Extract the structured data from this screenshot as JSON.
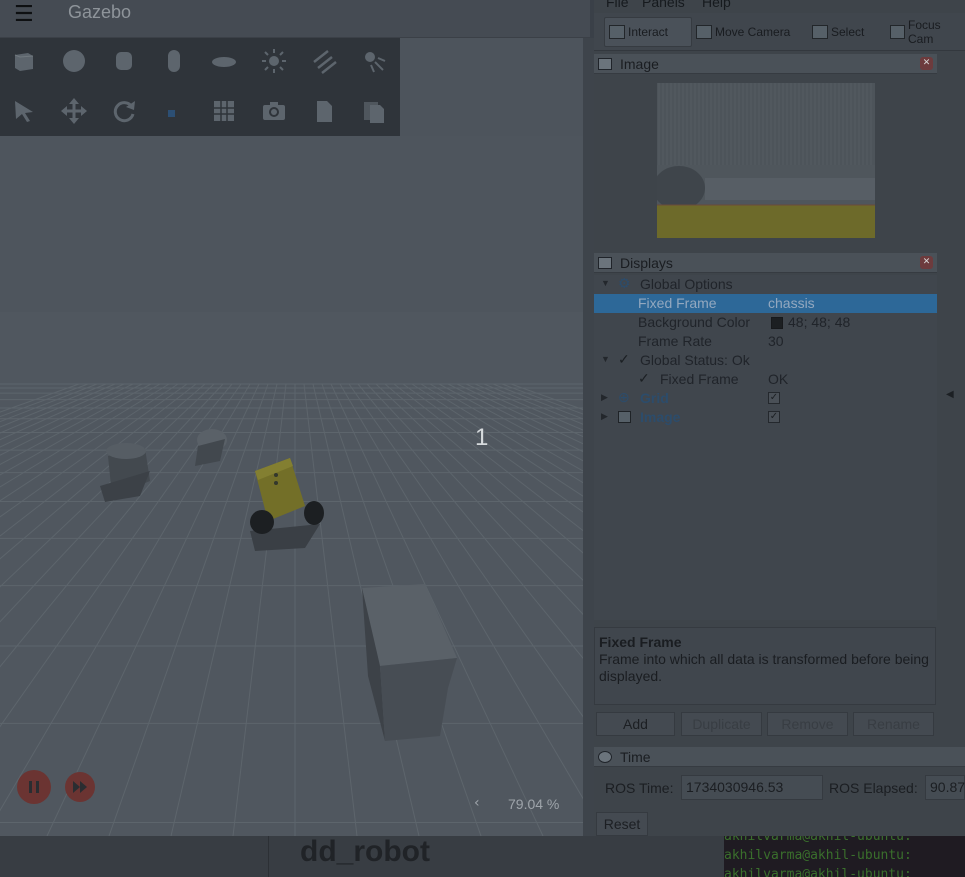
{
  "gazebo": {
    "title": "Gazebo",
    "menu_icon": "hamburger-icon",
    "toolbar_row1": [
      "box-icon",
      "sphere-icon",
      "cylinder-icon",
      "capsule-icon",
      "ellipsoid-icon",
      "point-light-icon",
      "directional-light-icon",
      "spot-light-icon"
    ],
    "toolbar_row2": [
      "select-arrow-icon",
      "translate-icon",
      "rotate-icon",
      "scale-icon",
      "align-grid-icon",
      "screenshot-icon",
      "copy-icon",
      "paste-icon"
    ],
    "scene_label": "1",
    "zoom_level": "79.04 %",
    "zoom_arrow": "‹",
    "accent_color": "#d1462f"
  },
  "rviz": {
    "menu": [
      "File",
      "Panels",
      "Help"
    ],
    "toolbar": {
      "interact": "Interact",
      "move_camera": "Move Camera",
      "select": "Select",
      "focus_camera": "Focus Cam"
    },
    "image_panel": {
      "title": "Image"
    },
    "displays_panel": {
      "title": "Displays",
      "rows": [
        {
          "label": "Global Options",
          "value": ""
        },
        {
          "label": "Fixed Frame",
          "value": "chassis"
        },
        {
          "label": "Background Color",
          "value": "48; 48; 48"
        },
        {
          "label": "Frame Rate",
          "value": "30"
        },
        {
          "label": "Global Status: Ok",
          "value": ""
        },
        {
          "label": "Fixed Frame",
          "value": "OK"
        },
        {
          "label": "Grid",
          "value": "✓"
        },
        {
          "label": "Image",
          "value": "✓"
        }
      ]
    },
    "help": {
      "title": "Fixed Frame",
      "text": "Frame into which all data is transformed before being displayed."
    },
    "buttons": {
      "add": "Add",
      "duplicate": "Duplicate",
      "remove": "Remove",
      "rename": "Rename"
    },
    "time_panel": {
      "title": "Time",
      "ros_time_label": "ROS Time:",
      "ros_time_value": "1734030946.53",
      "ros_elapsed_label": "ROS Elapsed:",
      "ros_elapsed_value": "90.87",
      "reset": "Reset"
    },
    "selection_color": "#2d6898"
  },
  "bottom": {
    "package_name": "dd_robot",
    "terminal_lines": [
      "akhilvarma@akhil-ubuntu:",
      "akhilvarma@akhil-ubuntu:",
      "akhilvarma@akhil-ubuntu:"
    ]
  }
}
